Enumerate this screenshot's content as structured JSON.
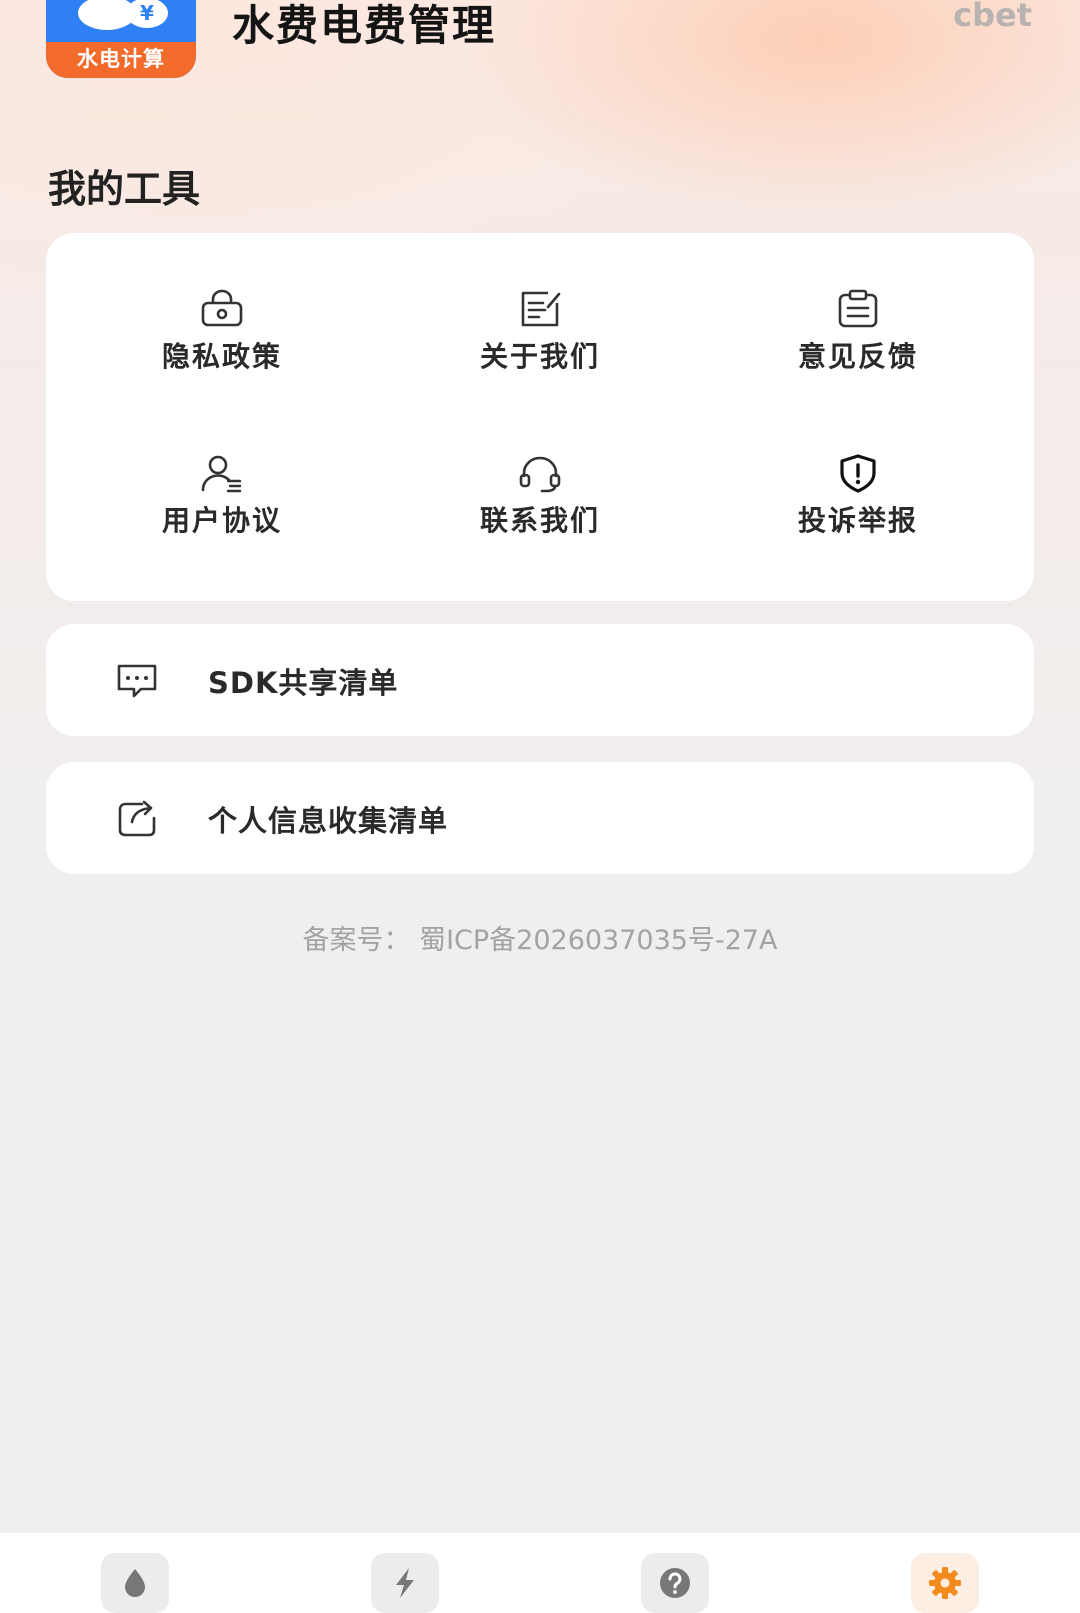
{
  "header": {
    "logo_text": "水电计算",
    "title": "水费电费管理",
    "watermark": "cbet"
  },
  "tools": {
    "title": "我的工具",
    "items": [
      {
        "label": "隐私政策",
        "icon": "lock-icon"
      },
      {
        "label": "关于我们",
        "icon": "edit-note-icon"
      },
      {
        "label": "意见反馈",
        "icon": "clipboard-icon"
      },
      {
        "label": "用户协议",
        "icon": "user-list-icon"
      },
      {
        "label": "联系我们",
        "icon": "headset-icon"
      },
      {
        "label": "投诉举报",
        "icon": "shield-alert-icon"
      }
    ]
  },
  "rows": [
    {
      "label": "SDK共享清单",
      "icon": "message-dots-icon"
    },
    {
      "label": "个人信息收集清单",
      "icon": "share-box-icon"
    }
  ],
  "footer": {
    "icp": "备案号： 蜀ICP备2026037035号-27A"
  },
  "tabbar": {
    "tabs": [
      {
        "icon": "water-drop-icon",
        "active": false
      },
      {
        "icon": "lightning-icon",
        "active": false
      },
      {
        "icon": "question-icon",
        "active": false
      },
      {
        "icon": "gear-icon",
        "active": true
      }
    ]
  },
  "colors": {
    "accent": "#f28a1e",
    "logo_blue": "#2f7ff5",
    "logo_orange": "#f26b2b"
  }
}
